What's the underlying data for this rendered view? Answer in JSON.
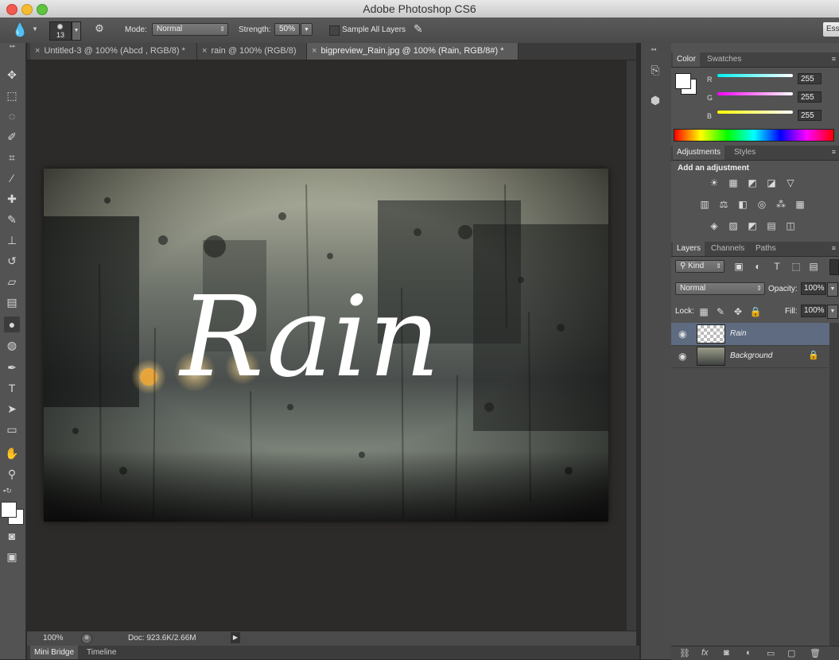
{
  "app": {
    "title": "Adobe Photoshop CS6"
  },
  "options": {
    "brush_size": "13",
    "mode_label": "Mode:",
    "mode_value": "Normal",
    "strength_label": "Strength:",
    "strength_value": "50%",
    "sample_all_layers": "Sample All Layers",
    "workspace": "Ess"
  },
  "tabs": [
    {
      "label": "Untitled-3 @ 100% (Abcd , RGB/8) *"
    },
    {
      "label": "rain @ 100% (RGB/8)"
    },
    {
      "label": "bigpreview_Rain.jpg @ 100% (Rain, RGB/8#) *"
    }
  ],
  "canvas": {
    "text": "Rain"
  },
  "status": {
    "zoom": "100%",
    "doc": "Doc: 923.6K/2.66M"
  },
  "bottom_tabs": [
    "Mini Bridge",
    "Timeline"
  ],
  "color_panel": {
    "tabs": [
      "Color",
      "Swatches"
    ],
    "channels": [
      {
        "label": "R",
        "value": "255",
        "color": "#00e0e0"
      },
      {
        "label": "G",
        "value": "255",
        "color": "#e040e0"
      },
      {
        "label": "B",
        "value": "255",
        "color": "#e8e800"
      }
    ]
  },
  "adjustments_panel": {
    "tabs": [
      "Adjustments",
      "Styles"
    ],
    "heading": "Add an adjustment"
  },
  "layers_panel": {
    "tabs": [
      "Layers",
      "Channels",
      "Paths"
    ],
    "filter": "Kind",
    "blend_mode": "Normal",
    "opacity_label": "Opacity:",
    "opacity_value": "100%",
    "lock_label": "Lock:",
    "fill_label": "Fill:",
    "fill_value": "100%",
    "layers": [
      {
        "name": "Rain"
      },
      {
        "name": "Background"
      }
    ]
  },
  "colors": {
    "accent_selection": "#5e6b80",
    "panel_bg": "#535353"
  }
}
